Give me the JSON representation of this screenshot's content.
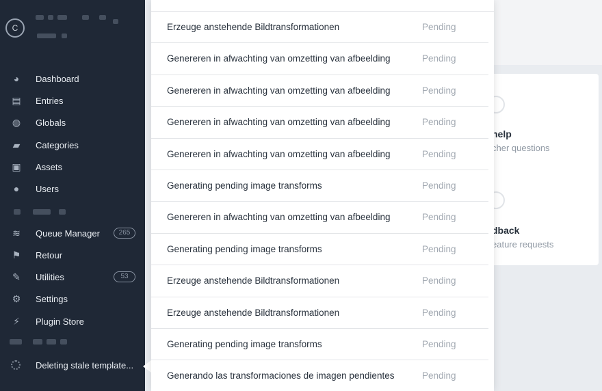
{
  "sidebar": {
    "logo_letter": "C",
    "items": [
      {
        "label": "Dashboard",
        "icon": "dashboard-icon",
        "glyph": "◕"
      },
      {
        "label": "Entries",
        "icon": "entries-icon",
        "glyph": "▤"
      },
      {
        "label": "Globals",
        "icon": "globe-icon",
        "glyph": "◍"
      },
      {
        "label": "Categories",
        "icon": "folder-icon",
        "glyph": "▰"
      },
      {
        "label": "Assets",
        "icon": "image-icon",
        "glyph": "▣"
      },
      {
        "label": "Users",
        "icon": "users-icon",
        "glyph": "●"
      },
      {
        "label": "Queue Manager",
        "icon": "stack-icon",
        "glyph": "≋",
        "badge": "265"
      },
      {
        "label": "Retour",
        "icon": "flag-icon",
        "glyph": "⚑"
      },
      {
        "label": "Utilities",
        "icon": "wrench-icon",
        "glyph": "✎",
        "badge": "53"
      },
      {
        "label": "Settings",
        "icon": "gear-icon",
        "glyph": "⚙"
      },
      {
        "label": "Plugin Store",
        "icon": "plug-icon",
        "glyph": "⚡"
      }
    ],
    "job_status": "Deleting stale template..."
  },
  "cards": {
    "help_title": "help",
    "help_sub": "cher questions",
    "feedback_title": "dback",
    "feedback_sub": "eature requests"
  },
  "jobs": [
    {
      "description": "Erzeuge anstehende Bildtransformationen",
      "status": "Pending"
    },
    {
      "description": "Genereren in afwachting van omzetting van afbeelding",
      "status": "Pending"
    },
    {
      "description": "Genereren in afwachting van omzetting van afbeelding",
      "status": "Pending"
    },
    {
      "description": "Genereren in afwachting van omzetting van afbeelding",
      "status": "Pending"
    },
    {
      "description": "Genereren in afwachting van omzetting van afbeelding",
      "status": "Pending"
    },
    {
      "description": "Generating pending image transforms",
      "status": "Pending"
    },
    {
      "description": "Genereren in afwachting van omzetting van afbeelding",
      "status": "Pending"
    },
    {
      "description": "Generating pending image transforms",
      "status": "Pending"
    },
    {
      "description": "Erzeuge anstehende Bildtransformationen",
      "status": "Pending"
    },
    {
      "description": "Erzeuge anstehende Bildtransformationen",
      "status": "Pending"
    },
    {
      "description": "Generating pending image transforms",
      "status": "Pending"
    },
    {
      "description": "Generando las transformaciones de imagen pendientes",
      "status": "Pending"
    }
  ]
}
